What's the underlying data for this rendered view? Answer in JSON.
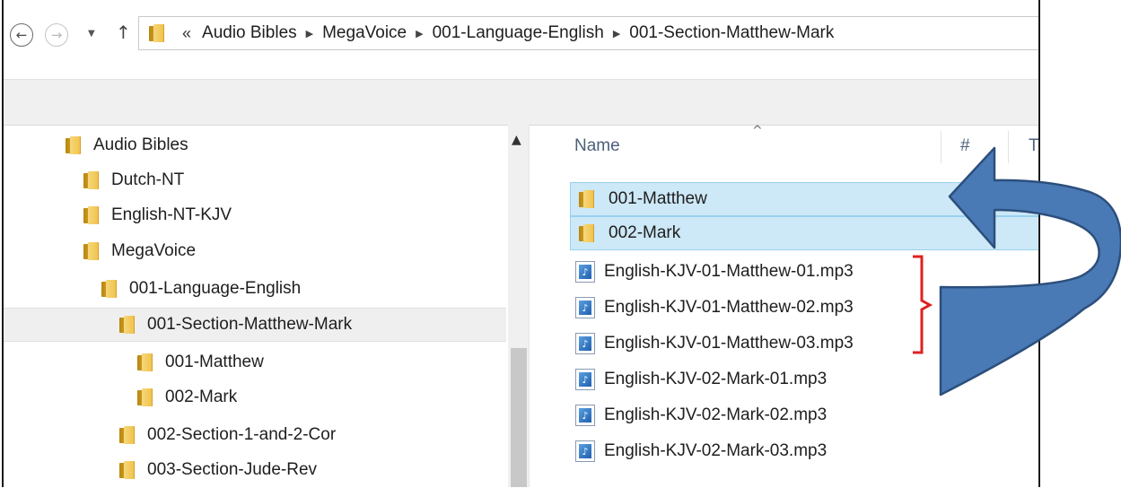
{
  "nav": {
    "back_icon": "←",
    "forward_icon": "→",
    "recent_dropdown_icon": "▼",
    "up_icon": "↑"
  },
  "address": {
    "overflow": "«",
    "crumbs": [
      "Audio Bibles",
      "MegaVoice",
      "001-Language-English",
      "001-Section-Matthew-Mark"
    ],
    "separator": "▶"
  },
  "tree": {
    "scroll_up_icon": "▲",
    "items": [
      {
        "label": "Audio Bibles"
      },
      {
        "label": "Dutch-NT"
      },
      {
        "label": "English-NT-KJV"
      },
      {
        "label": "MegaVoice"
      },
      {
        "label": "001-Language-English"
      },
      {
        "label": "001-Section-Matthew-Mark"
      },
      {
        "label": "001-Matthew"
      },
      {
        "label": "002-Mark"
      },
      {
        "label": "002-Section-1-and-2-Cor"
      },
      {
        "label": "003-Section-Jude-Rev"
      }
    ]
  },
  "files": {
    "columns": {
      "name": "Name",
      "number": "#",
      "title_partial": "T"
    },
    "sort_caret": "^",
    "music_icon_glyph": "♪",
    "items": [
      {
        "name": "001-Matthew",
        "type": "folder",
        "selected": true
      },
      {
        "name": "002-Mark",
        "type": "folder",
        "selected": true
      },
      {
        "name": "English-KJV-01-Matthew-01.mp3",
        "type": "mp3"
      },
      {
        "name": "English-KJV-01-Matthew-02.mp3",
        "type": "mp3"
      },
      {
        "name": "English-KJV-01-Matthew-03.mp3",
        "type": "mp3"
      },
      {
        "name": "English-KJV-02-Mark-01.mp3",
        "type": "mp3"
      },
      {
        "name": "English-KJV-02-Mark-02.mp3",
        "type": "mp3"
      },
      {
        "name": "English-KJV-02-Mark-03.mp3",
        "type": "mp3"
      }
    ]
  },
  "annotation": {
    "bracket_color": "#e02020",
    "arrow_fill": "#4a7ab5",
    "arrow_stroke": "#2c4f7c"
  },
  "colors": {
    "selection_bg": "#cde8f7",
    "selection_border": "#99d1ef",
    "header_text": "#4c607a"
  }
}
